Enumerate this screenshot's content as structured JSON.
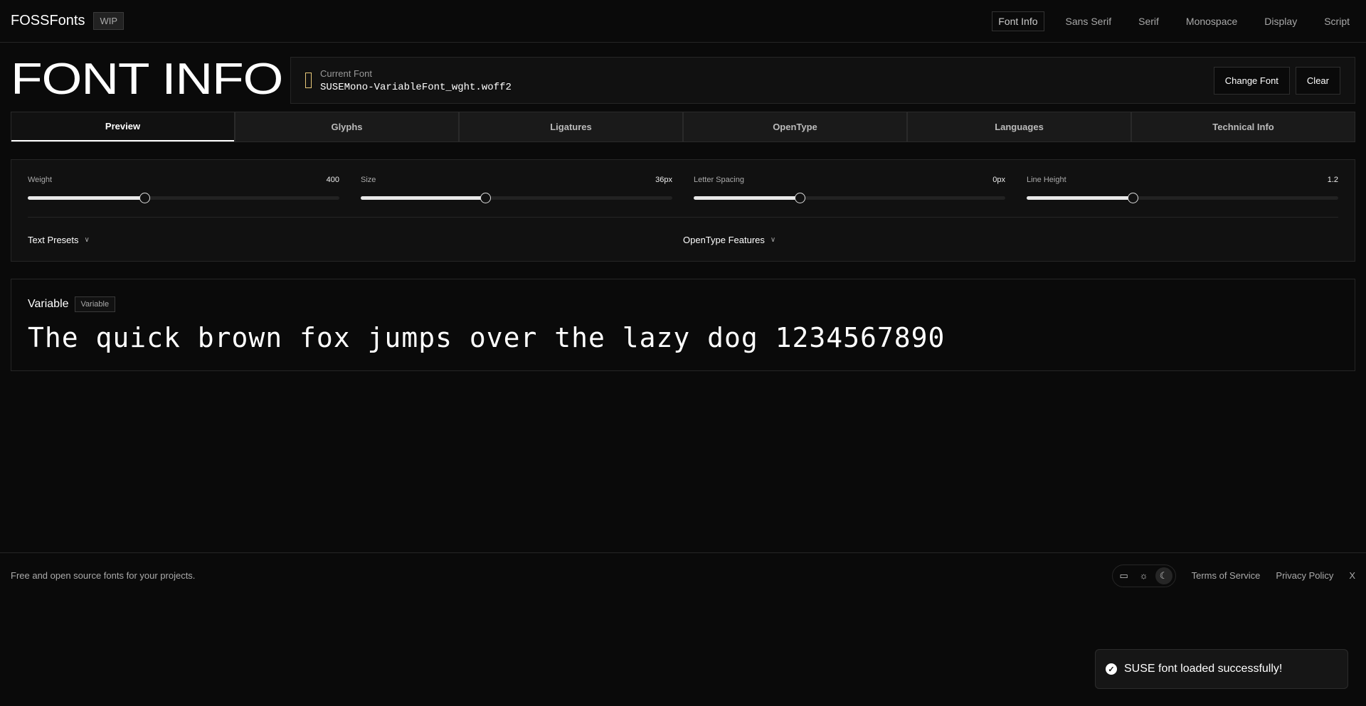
{
  "header": {
    "logo": "FOSSFonts",
    "badge": "WIP",
    "nav": [
      "Font Info",
      "Sans Serif",
      "Serif",
      "Monospace",
      "Display",
      "Script"
    ]
  },
  "title": "FONT INFO",
  "current": {
    "label": "Current Font",
    "value": "SUSEMono-VariableFont_wght.woff2",
    "change": "Change Font",
    "clear": "Clear"
  },
  "tabs": [
    "Preview",
    "Glyphs",
    "Ligatures",
    "OpenType",
    "Languages",
    "Technical Info"
  ],
  "sliders": [
    {
      "label": "Weight",
      "value": "400",
      "fraction": 0.375
    },
    {
      "label": "Size",
      "value": "36px",
      "fraction": 0.4
    },
    {
      "label": "Letter Spacing",
      "value": "0px",
      "fraction": 0.34
    },
    {
      "label": "Line Height",
      "value": "1.2",
      "fraction": 0.34
    }
  ],
  "presets": {
    "text": "Text Presets",
    "opentype": "OpenType Features"
  },
  "preview": {
    "title": "Variable",
    "badge": "Variable",
    "sample": "The quick brown fox jumps over the lazy dog 1234567890"
  },
  "footer": {
    "tagline": "Free and open source fonts for your projects.",
    "terms": "Terms of Service",
    "privacy": "Privacy Policy",
    "x": "X"
  },
  "toast": {
    "message": "SUSE font loaded successfully!"
  }
}
